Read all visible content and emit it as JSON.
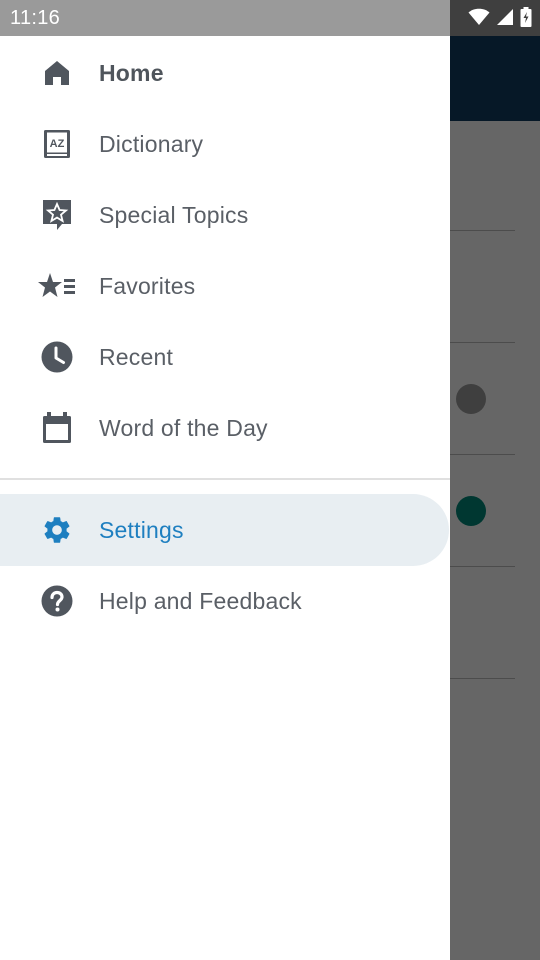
{
  "status_bar": {
    "time": "11:16"
  },
  "drawer": {
    "items": [
      {
        "label": "Home",
        "icon": "home-icon"
      },
      {
        "label": "Dictionary",
        "icon": "dictionary-icon"
      },
      {
        "label": "Special Topics",
        "icon": "special-topics-icon"
      },
      {
        "label": "Favorites",
        "icon": "favorites-icon"
      },
      {
        "label": "Recent",
        "icon": "recent-clock-icon"
      },
      {
        "label": "Word of the Day",
        "icon": "calendar-icon"
      },
      {
        "label": "Settings",
        "icon": "gear-icon",
        "selected": true
      },
      {
        "label": "Help and Feedback",
        "icon": "help-icon"
      }
    ]
  },
  "colors": {
    "icon_gray": "#50565e",
    "selected_text": "#1e7fc0",
    "selected_bg": "#e8eef2",
    "toolbar": "#0f3c63"
  }
}
